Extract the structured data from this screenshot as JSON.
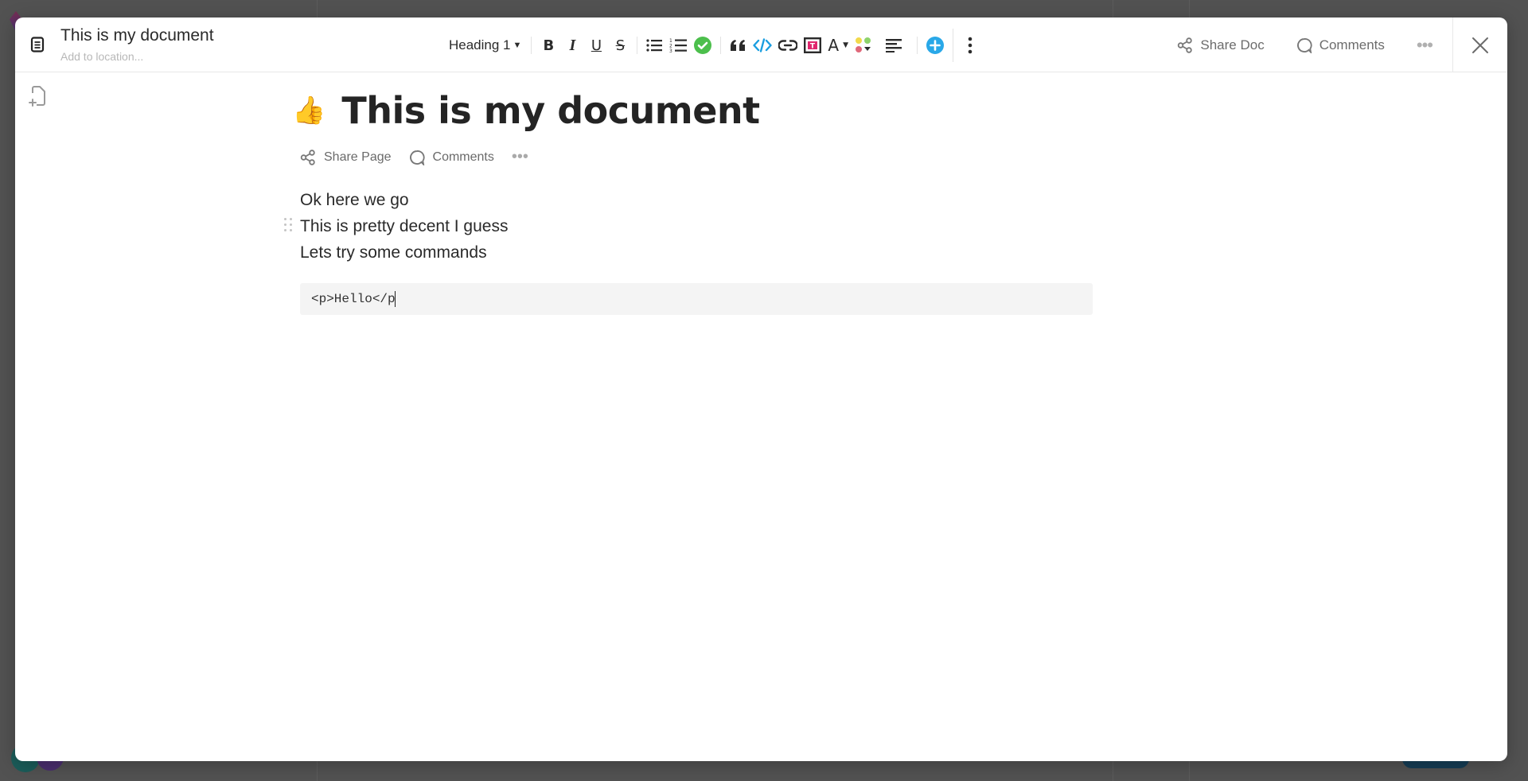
{
  "window": {
    "title": "This is my document",
    "location_placeholder": "Add to location..."
  },
  "toolbar": {
    "block_type": "Heading 1",
    "bold_label": "B",
    "italic_label": "I",
    "underline_label": "U",
    "strike_label": "S",
    "text_color_label": "A",
    "colors": {
      "check": "#4cbf4c",
      "code": "#1a9ee0",
      "add": "#29a8e8",
      "badge_pink": "#e0266d"
    }
  },
  "header_actions": {
    "share_doc": "Share Doc",
    "comments": "Comments",
    "more": "•••"
  },
  "page": {
    "emoji": "👍",
    "heading": "This is my document",
    "share_page": "Share Page",
    "comments": "Comments",
    "more": "•••",
    "lines": [
      "Ok here we go",
      "This is pretty decent I guess",
      "Lets try some commands"
    ],
    "code": "<p>Hello</p"
  }
}
